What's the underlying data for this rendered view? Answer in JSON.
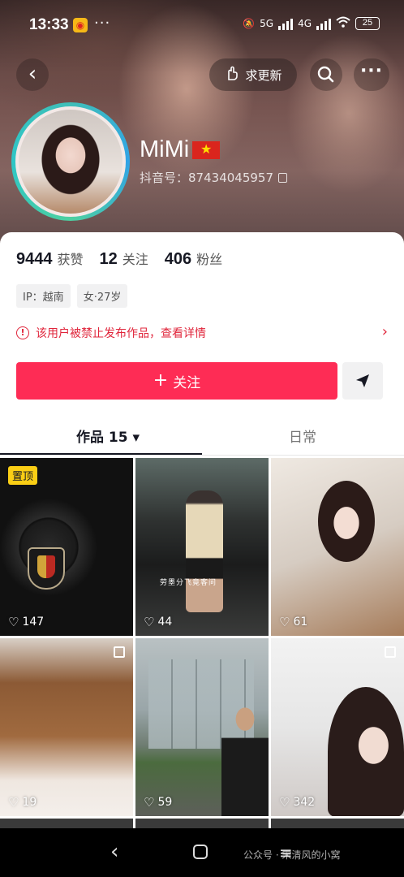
{
  "status_bar": {
    "time": "13:33",
    "app_icon": "weibo-icon",
    "dots": "···",
    "network_5g": "5G",
    "network_4g": "4G",
    "battery": "25"
  },
  "header": {
    "back_icon": "chevron-left-icon",
    "update_label": "求更新",
    "search_icon": "search-icon",
    "more_icon": "more-icon"
  },
  "profile": {
    "nickname": "MiMi",
    "flag": "vietnam-flag",
    "douyin_id_label": "抖音号：",
    "douyin_id": "87434045957"
  },
  "stats": [
    {
      "value": "9444",
      "label": "获赞"
    },
    {
      "value": "12",
      "label": "关注"
    },
    {
      "value": "406",
      "label": "粉丝"
    }
  ],
  "tags": [
    "IP：越南",
    "女·27岁"
  ],
  "notice": {
    "text": "该用户被禁止发布作品，查看详情",
    "chevron": "›"
  },
  "actions": {
    "follow_plus": "+",
    "follow_label": "关注",
    "share_icon": "send-icon"
  },
  "tabs": {
    "works": "作品 15 ▾",
    "daily": "日常"
  },
  "grid": [
    {
      "likes": "147",
      "pinned_label": "置顶"
    },
    {
      "likes": "44",
      "caption": "劳墨分飞竟客问"
    },
    {
      "likes": "61"
    },
    {
      "likes": "19"
    },
    {
      "likes": "59"
    },
    {
      "likes": "342"
    }
  ],
  "navbar": {
    "back": "‹",
    "recent": "≡"
  },
  "watermark": "公众号 · 宋清风的小窝"
}
